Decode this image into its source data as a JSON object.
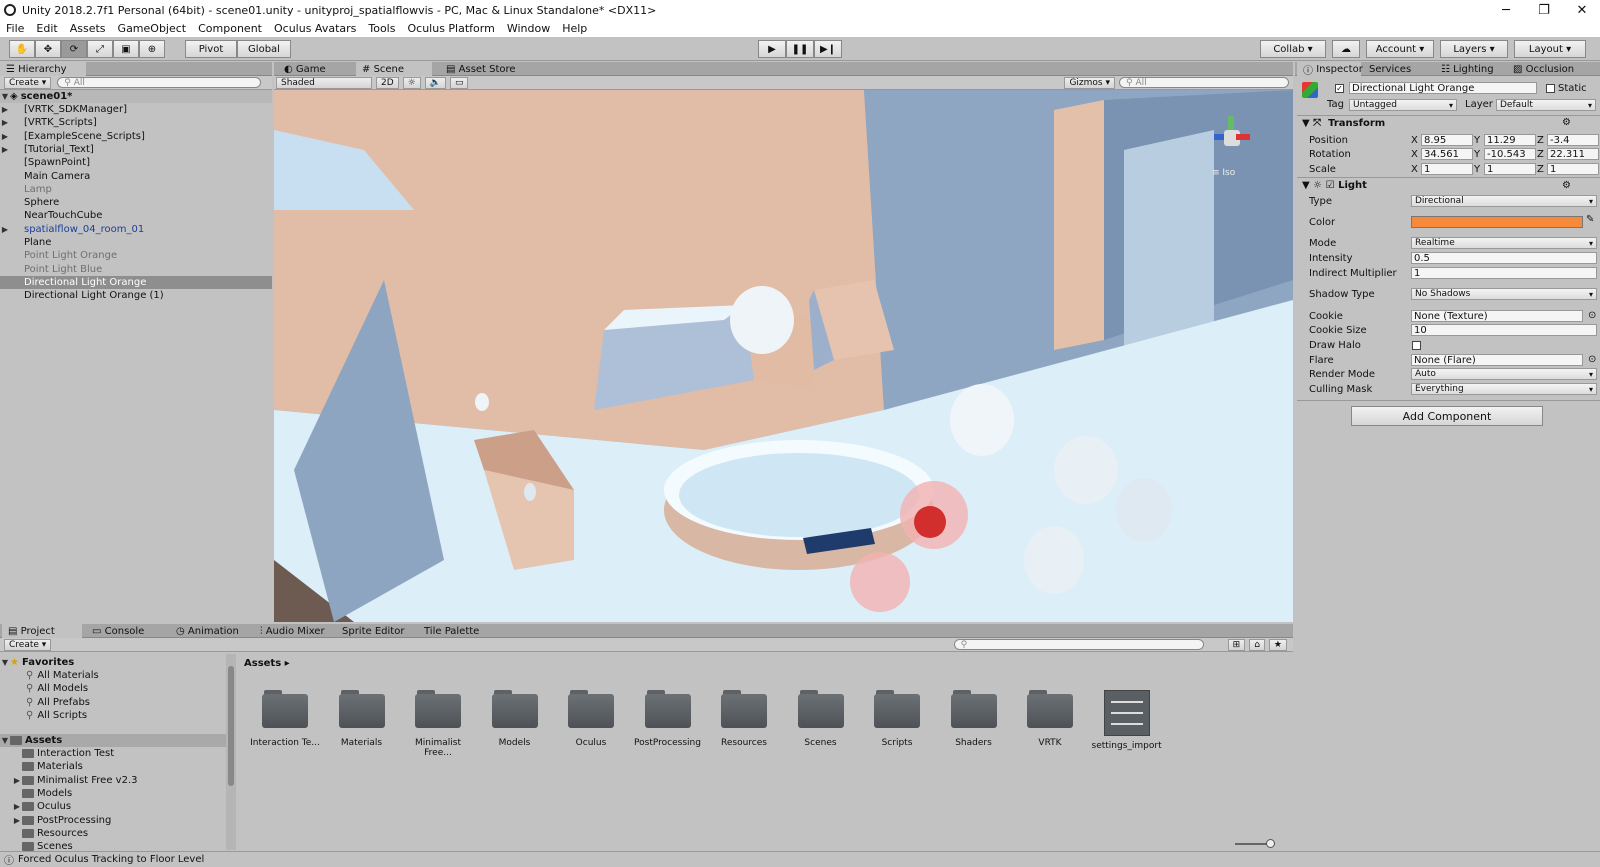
{
  "window": {
    "title": "Unity 2018.2.7f1 Personal (64bit) - scene01.unity - unityproj_spatialflowvis - PC, Mac & Linux Standalone* <DX11>"
  },
  "menu": [
    "File",
    "Edit",
    "Assets",
    "GameObject",
    "Component",
    "Oculus Avatars",
    "Tools",
    "Oculus Platform",
    "Window",
    "Help"
  ],
  "toolbar": {
    "pivot": "Pivot",
    "global": "Global",
    "collab": "Collab",
    "account": "Account",
    "layers": "Layers",
    "layout": "Layout"
  },
  "hierarchy": {
    "tab": "Hierarchy",
    "create": "Create",
    "search_placeholder": "All",
    "scene": "scene01*",
    "items": [
      {
        "label": "[VRTK_SDKManager]",
        "expand": true,
        "style": "normal"
      },
      {
        "label": "[VRTK_Scripts]",
        "expand": true,
        "style": "normal"
      },
      {
        "label": "[ExampleScene_Scripts]",
        "expand": true,
        "style": "normal"
      },
      {
        "label": "[Tutorial_Text]",
        "expand": true,
        "style": "normal"
      },
      {
        "label": "[SpawnPoint]",
        "expand": false,
        "style": "normal"
      },
      {
        "label": "Main Camera",
        "expand": false,
        "style": "normal"
      },
      {
        "label": "Lamp",
        "expand": false,
        "style": "dim"
      },
      {
        "label": "Sphere",
        "expand": false,
        "style": "normal"
      },
      {
        "label": "NearTouchCube",
        "expand": false,
        "style": "normal"
      },
      {
        "label": "spatialflow_04_room_01",
        "expand": true,
        "style": "prefab"
      },
      {
        "label": "Plane",
        "expand": false,
        "style": "normal"
      },
      {
        "label": "Point Light Orange",
        "expand": false,
        "style": "dim"
      },
      {
        "label": "Point Light Blue",
        "expand": false,
        "style": "dim"
      },
      {
        "label": "Directional Light Orange",
        "expand": false,
        "style": "selected"
      },
      {
        "label": "Directional Light Orange (1)",
        "expand": false,
        "style": "normal"
      }
    ]
  },
  "scene_tabs": {
    "game": "Game",
    "scene": "Scene",
    "asset_store": "Asset Store",
    "shaded": "Shaded",
    "mode_2d": "2D",
    "gizmos": "Gizmos",
    "search_placeholder": "All",
    "iso": "Iso"
  },
  "inspector": {
    "tabs": [
      "Inspector",
      "Services",
      "Lighting",
      "Occlusion"
    ],
    "object_name": "Directional Light Orange",
    "static": "Static",
    "tag_label": "Tag",
    "tag": "Untagged",
    "layer_label": "Layer",
    "layer": "Default",
    "transform": {
      "title": "Transform",
      "position": {
        "label": "Position",
        "x": "8.95",
        "y": "11.29",
        "z": "-3.4"
      },
      "rotation": {
        "label": "Rotation",
        "x": "34.561",
        "y": "-10.543",
        "z": "22.311"
      },
      "scale": {
        "label": "Scale",
        "x": "1",
        "y": "1",
        "z": "1"
      },
      "axis": {
        "x": "X",
        "y": "Y",
        "z": "Z"
      }
    },
    "light": {
      "title": "Light",
      "type_label": "Type",
      "type": "Directional",
      "color_label": "Color",
      "color": "#f7893a",
      "mode_label": "Mode",
      "mode": "Realtime",
      "intensity_label": "Intensity",
      "intensity": "0.5",
      "indirect_label": "Indirect Multiplier",
      "indirect": "1",
      "shadow_label": "Shadow Type",
      "shadow": "No Shadows",
      "cookie_label": "Cookie",
      "cookie": "None (Texture)",
      "cookie_size_label": "Cookie Size",
      "cookie_size": "10",
      "halo_label": "Draw Halo",
      "flare_label": "Flare",
      "flare": "None (Flare)",
      "render_label": "Render Mode",
      "render": "Auto",
      "culling_label": "Culling Mask",
      "culling": "Everything"
    },
    "add_component": "Add Component"
  },
  "bottom_tabs": [
    "Project",
    "Console",
    "Animation",
    "Audio Mixer",
    "Sprite Editor",
    "Tile Palette"
  ],
  "project": {
    "create": "Create",
    "favorites": "Favorites",
    "fav_items": [
      "All Materials",
      "All Models",
      "All Prefabs",
      "All Scripts"
    ],
    "assets_root": "Assets",
    "tree": [
      "Interaction Test",
      "Materials",
      "Minimalist Free v2.3",
      "Models",
      "Oculus",
      "PostProcessing",
      "Resources",
      "Scenes"
    ],
    "breadcrumb": "Assets",
    "grid": [
      "Interaction Te...",
      "Materials",
      "Minimalist Free...",
      "Models",
      "Oculus",
      "PostProcessing",
      "Resources",
      "Scenes",
      "Scripts",
      "Shaders",
      "VRTK",
      "settings_import"
    ]
  },
  "status": "Forced Oculus Tracking to Floor Level"
}
